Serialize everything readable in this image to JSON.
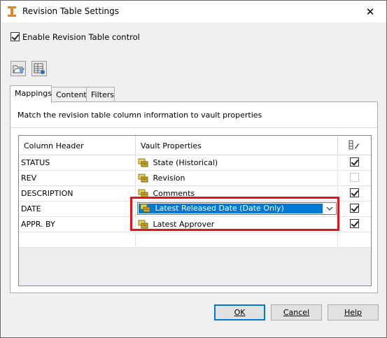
{
  "window": {
    "title": "Revision Table Settings",
    "close_glyph": "✕"
  },
  "enable_control": {
    "label": "Enable Revision Table control",
    "checked": true
  },
  "toolbar": {
    "buttons": [
      {
        "icon": "open-folder-icon"
      },
      {
        "icon": "table-settings-icon"
      }
    ]
  },
  "tabs": [
    {
      "label": "Mappings",
      "active": true
    },
    {
      "label": "Content",
      "active": false
    },
    {
      "label": "Filters",
      "active": false
    }
  ],
  "mappings": {
    "instruction": "Match the revision table column information to vault properties",
    "columns": {
      "header": "Column Header",
      "property": "Vault Properties",
      "icon": "edit-column-icon"
    },
    "rows": [
      {
        "header": "STATUS",
        "property": "State (Historical)",
        "checked": true
      },
      {
        "header": "REV",
        "property": "Revision",
        "checked": false
      },
      {
        "header": "DESCRIPTION",
        "property": "Comments",
        "checked": true
      },
      {
        "header": "DATE",
        "property": "Latest Released Date (Date Only)",
        "checked": true,
        "editing": true
      },
      {
        "header": "APPR. BY",
        "property": "Latest Approver",
        "checked": true
      }
    ]
  },
  "buttons": {
    "ok": "OK",
    "cancel": "Cancel",
    "help": "Help"
  },
  "colors": {
    "highlight": "#e3151a",
    "selection": "#0078d7"
  }
}
